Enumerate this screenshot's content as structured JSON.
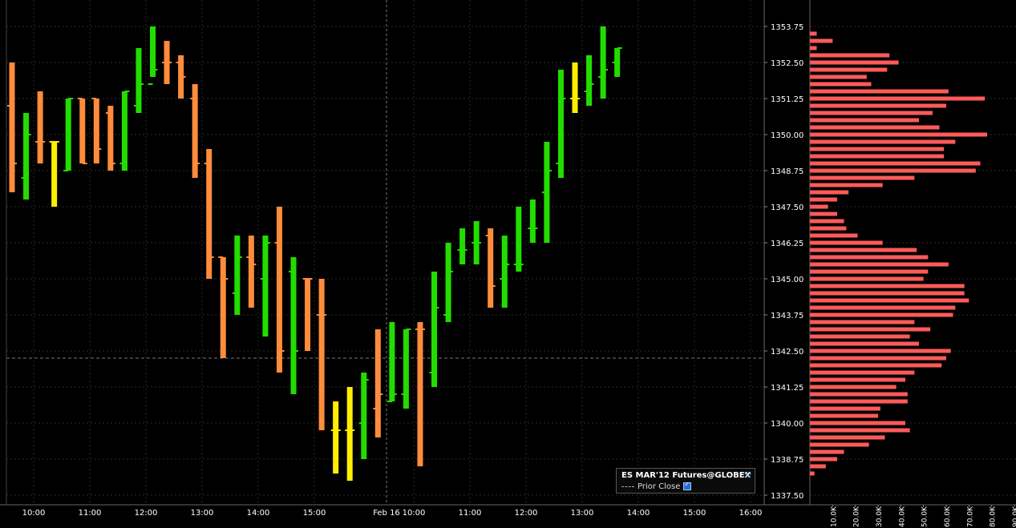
{
  "chart_data": {
    "type": "ohlc",
    "legend": {
      "instrument": "ES MAR'12 Futures@GLOBEX",
      "series_label": "Prior Close",
      "placement": "bottom-right",
      "series_visible": true
    },
    "ylim": [
      1337.0,
      1354.5
    ],
    "y_ticks": [
      "1353.75",
      "1352.50",
      "1351.25",
      "1350.00",
      "1348.75",
      "1347.50",
      "1346.25",
      "1345.00",
      "1343.75",
      "1342.50",
      "1341.25",
      "1340.00",
      "1338.75",
      "1337.50"
    ],
    "x_ticks": [
      "10:00",
      "11:00",
      "12:00",
      "13:00",
      "14:00",
      "15:00",
      "Feb 16",
      "10:00",
      "11:00",
      "12:00",
      "13:00",
      "14:00",
      "15:00",
      "16:00"
    ],
    "prior_close": 1342.25,
    "session_divider_label": "Feb 16",
    "colors": {
      "up": "#22dd00",
      "down": "#ff8c3c",
      "neutral": "#ffee00",
      "profile": "#ff5a5a",
      "grid": "#2a2a2a"
    },
    "bars": [
      {
        "o": 1351.0,
        "h": 1352.5,
        "l": 1348.0,
        "c": 1349.0,
        "color": "down"
      },
      {
        "o": 1348.5,
        "h": 1350.75,
        "l": 1347.75,
        "c": 1350.0,
        "color": "up"
      },
      {
        "o": 1349.75,
        "h": 1351.5,
        "l": 1349.0,
        "c": 1349.75,
        "color": "down"
      },
      {
        "o": 1349.75,
        "h": 1349.75,
        "l": 1347.5,
        "c": 1349.75,
        "color": "neutral"
      },
      {
        "o": 1348.75,
        "h": 1351.25,
        "l": 1348.75,
        "c": 1351.25,
        "color": "up"
      },
      {
        "o": 1351.25,
        "h": 1351.25,
        "l": 1349.0,
        "c": 1349.0,
        "color": "down"
      },
      {
        "o": 1351.25,
        "h": 1351.25,
        "l": 1349.0,
        "c": 1349.5,
        "color": "down"
      },
      {
        "o": 1350.75,
        "h": 1351.0,
        "l": 1348.75,
        "c": 1349.0,
        "color": "down"
      },
      {
        "o": 1349.0,
        "h": 1351.5,
        "l": 1348.75,
        "c": 1351.5,
        "color": "up"
      },
      {
        "o": 1351.0,
        "h": 1353.0,
        "l": 1350.75,
        "c": 1351.75,
        "color": "up"
      },
      {
        "o": 1351.75,
        "h": 1353.75,
        "l": 1352.0,
        "c": 1352.25,
        "color": "up"
      },
      {
        "o": 1352.5,
        "h": 1353.25,
        "l": 1351.75,
        "c": 1352.5,
        "color": "down"
      },
      {
        "o": 1352.5,
        "h": 1352.75,
        "l": 1351.25,
        "c": 1352.0,
        "color": "down"
      },
      {
        "o": 1351.25,
        "h": 1351.75,
        "l": 1348.5,
        "c": 1349.0,
        "color": "down"
      },
      {
        "o": 1349.0,
        "h": 1349.5,
        "l": 1345.0,
        "c": 1345.75,
        "color": "down"
      },
      {
        "o": 1345.75,
        "h": 1345.75,
        "l": 1342.25,
        "c": 1345.0,
        "color": "down"
      },
      {
        "o": 1344.5,
        "h": 1346.5,
        "l": 1343.75,
        "c": 1345.75,
        "color": "up"
      },
      {
        "o": 1345.75,
        "h": 1346.5,
        "l": 1344.0,
        "c": 1345.5,
        "color": "down"
      },
      {
        "o": 1345.0,
        "h": 1346.5,
        "l": 1343.0,
        "c": 1346.25,
        "color": "up"
      },
      {
        "o": 1346.25,
        "h": 1347.5,
        "l": 1341.75,
        "c": 1342.5,
        "color": "down"
      },
      {
        "o": 1345.25,
        "h": 1345.75,
        "l": 1341.0,
        "c": 1342.5,
        "color": "up"
      },
      {
        "o": 1345.0,
        "h": 1345.0,
        "l": 1342.5,
        "c": 1345.0,
        "color": "down"
      },
      {
        "o": 1343.75,
        "h": 1345.0,
        "l": 1339.75,
        "c": 1343.75,
        "color": "down"
      },
      {
        "o": 1339.75,
        "h": 1340.75,
        "l": 1338.25,
        "c": 1339.75,
        "color": "neutral"
      },
      {
        "o": 1339.75,
        "h": 1341.25,
        "l": 1338.0,
        "c": 1339.75,
        "color": "neutral"
      },
      {
        "o": 1340.0,
        "h": 1341.75,
        "l": 1338.75,
        "c": 1341.5,
        "color": "up"
      },
      {
        "o": 1340.5,
        "h": 1343.25,
        "l": 1339.5,
        "c": 1341.0,
        "color": "down"
      },
      {
        "o": 1340.75,
        "h": 1343.5,
        "l": 1340.75,
        "c": 1341.0,
        "color": "up"
      },
      {
        "o": 1341.0,
        "h": 1343.25,
        "l": 1340.5,
        "c": 1343.25,
        "color": "up"
      },
      {
        "o": 1343.25,
        "h": 1343.5,
        "l": 1338.5,
        "c": 1343.25,
        "color": "down"
      },
      {
        "o": 1341.75,
        "h": 1345.25,
        "l": 1341.25,
        "c": 1344.0,
        "color": "up"
      },
      {
        "o": 1343.75,
        "h": 1346.25,
        "l": 1343.5,
        "c": 1345.25,
        "color": "up"
      },
      {
        "o": 1346.0,
        "h": 1346.75,
        "l": 1345.5,
        "c": 1346.0,
        "color": "up"
      },
      {
        "o": 1346.25,
        "h": 1347.0,
        "l": 1345.5,
        "c": 1346.25,
        "color": "up"
      },
      {
        "o": 1346.5,
        "h": 1346.75,
        "l": 1344.0,
        "c": 1344.75,
        "color": "down"
      },
      {
        "o": 1345.0,
        "h": 1346.5,
        "l": 1344.0,
        "c": 1345.5,
        "color": "up"
      },
      {
        "o": 1345.5,
        "h": 1347.5,
        "l": 1345.25,
        "c": 1345.5,
        "color": "up"
      },
      {
        "o": 1346.75,
        "h": 1347.75,
        "l": 1346.25,
        "c": 1346.75,
        "color": "up"
      },
      {
        "o": 1348.0,
        "h": 1349.75,
        "l": 1346.25,
        "c": 1348.75,
        "color": "up"
      },
      {
        "o": 1349.0,
        "h": 1352.25,
        "l": 1348.5,
        "c": 1351.25,
        "color": "up"
      },
      {
        "o": 1351.25,
        "h": 1352.5,
        "l": 1350.75,
        "c": 1351.25,
        "color": "neutral"
      },
      {
        "o": 1351.5,
        "h": 1352.75,
        "l": 1351.0,
        "c": 1351.75,
        "color": "up"
      },
      {
        "o": 1352.0,
        "h": 1353.75,
        "l": 1351.25,
        "c": 1352.25,
        "color": "up"
      },
      {
        "o": 1352.5,
        "h": 1353.0,
        "l": 1352.0,
        "c": 1353.0,
        "color": "up"
      }
    ],
    "volume_profile": {
      "x_ticks": [
        "10.0K",
        "20.0K",
        "30.0K",
        "40.0K",
        "50.0K",
        "60.0K",
        "70.0K",
        "80.0K",
        "90.0K"
      ],
      "xlim": [
        0,
        90000
      ],
      "levels": [
        [
          1353.5,
          3000
        ],
        [
          1353.25,
          10000
        ],
        [
          1353.0,
          3000
        ],
        [
          1352.75,
          35000
        ],
        [
          1352.5,
          39000
        ],
        [
          1352.25,
          34000
        ],
        [
          1352.0,
          25000
        ],
        [
          1351.75,
          27000
        ],
        [
          1351.5,
          61000
        ],
        [
          1351.25,
          77000
        ],
        [
          1351.0,
          60000
        ],
        [
          1350.75,
          54000
        ],
        [
          1350.5,
          48000
        ],
        [
          1350.25,
          57000
        ],
        [
          1350.0,
          78000
        ],
        [
          1349.75,
          64000
        ],
        [
          1349.5,
          59000
        ],
        [
          1349.25,
          59000
        ],
        [
          1349.0,
          75000
        ],
        [
          1348.75,
          73000
        ],
        [
          1348.5,
          46000
        ],
        [
          1348.25,
          32000
        ],
        [
          1348.0,
          17000
        ],
        [
          1347.75,
          12000
        ],
        [
          1347.5,
          8000
        ],
        [
          1347.25,
          12000
        ],
        [
          1347.0,
          15000
        ],
        [
          1346.75,
          16000
        ],
        [
          1346.5,
          21000
        ],
        [
          1346.25,
          32000
        ],
        [
          1346.0,
          47000
        ],
        [
          1345.75,
          52000
        ],
        [
          1345.5,
          61000
        ],
        [
          1345.25,
          52000
        ],
        [
          1345.0,
          50000
        ],
        [
          1344.75,
          68000
        ],
        [
          1344.5,
          68000
        ],
        [
          1344.25,
          70000
        ],
        [
          1344.0,
          64000
        ],
        [
          1343.75,
          63000
        ],
        [
          1343.5,
          46000
        ],
        [
          1343.25,
          53000
        ],
        [
          1343.0,
          44000
        ],
        [
          1342.75,
          48000
        ],
        [
          1342.5,
          62000
        ],
        [
          1342.25,
          60000
        ],
        [
          1342.0,
          58000
        ],
        [
          1341.75,
          46000
        ],
        [
          1341.5,
          42000
        ],
        [
          1341.25,
          38000
        ],
        [
          1341.0,
          43000
        ],
        [
          1340.75,
          43000
        ],
        [
          1340.5,
          31000
        ],
        [
          1340.25,
          30000
        ],
        [
          1340.0,
          42000
        ],
        [
          1339.75,
          44000
        ],
        [
          1339.5,
          33000
        ],
        [
          1339.25,
          26000
        ],
        [
          1339.0,
          15000
        ],
        [
          1338.75,
          12000
        ],
        [
          1338.5,
          7000
        ],
        [
          1338.25,
          2000
        ]
      ]
    }
  }
}
